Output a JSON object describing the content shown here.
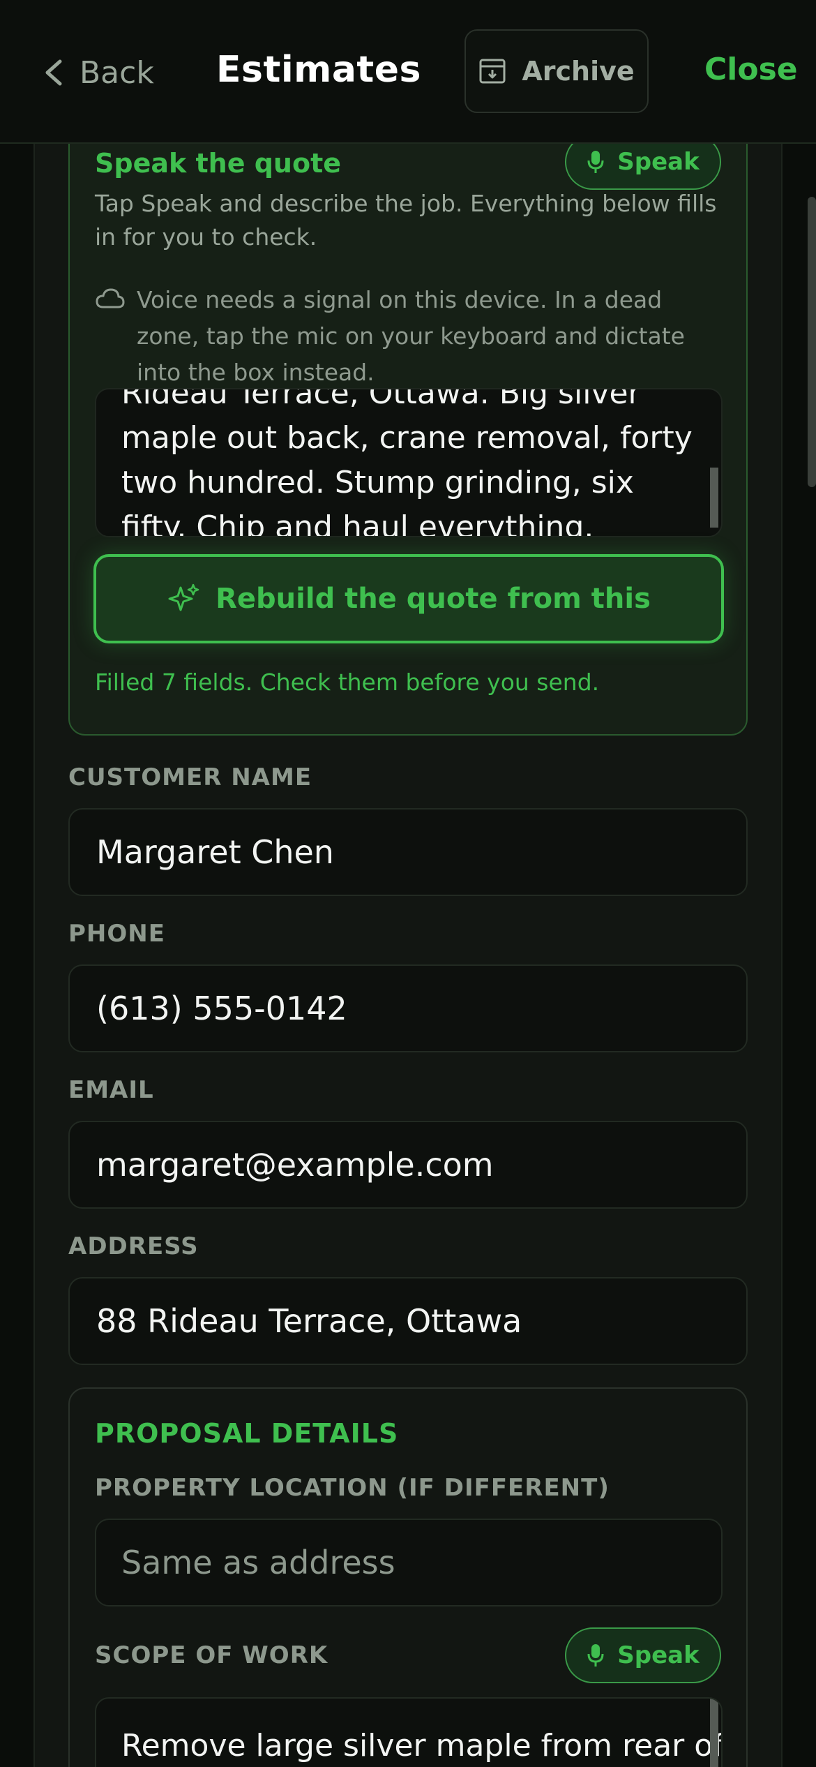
{
  "header": {
    "back_label": "Back",
    "title": "Estimates",
    "archive_label": "Archive",
    "close_label": "Close"
  },
  "speak_card": {
    "title": "Speak the quote",
    "speak_label": "Speak",
    "description": "Tap Speak and describe the job. Everything below fills in for you to check.",
    "voice_note": "Voice needs a signal on this device. In a dead zone, tap the mic on your keyboard and dictate into the box instead.",
    "transcript": "Rideau Terrace, Ottawa. Big silver maple out back, crane removal, forty two hundred. Stump grinding, six fifty. Chip and haul everything.",
    "rebuild_label": "Rebuild the quote from this",
    "filled_message": "Filled 7 fields. Check them before you send."
  },
  "fields": {
    "customer_name": {
      "label": "CUSTOMER NAME",
      "value": "Margaret Chen"
    },
    "phone": {
      "label": "PHONE",
      "value": "(613) 555-0142"
    },
    "email": {
      "label": "EMAIL",
      "value": "margaret@example.com"
    },
    "address": {
      "label": "ADDRESS",
      "value": "88 Rideau Terrace, Ottawa"
    }
  },
  "proposal": {
    "title": "PROPOSAL DETAILS",
    "location_label": "PROPERTY LOCATION (IF DIFFERENT)",
    "location_placeholder": "Same as address",
    "scope_label": "SCOPE OF WORK",
    "scope_speak_label": "Speak",
    "scope_text": "Remove large silver maple from rear of"
  },
  "colors": {
    "accent": "#3fbf4f",
    "background": "#0a0d0a"
  }
}
